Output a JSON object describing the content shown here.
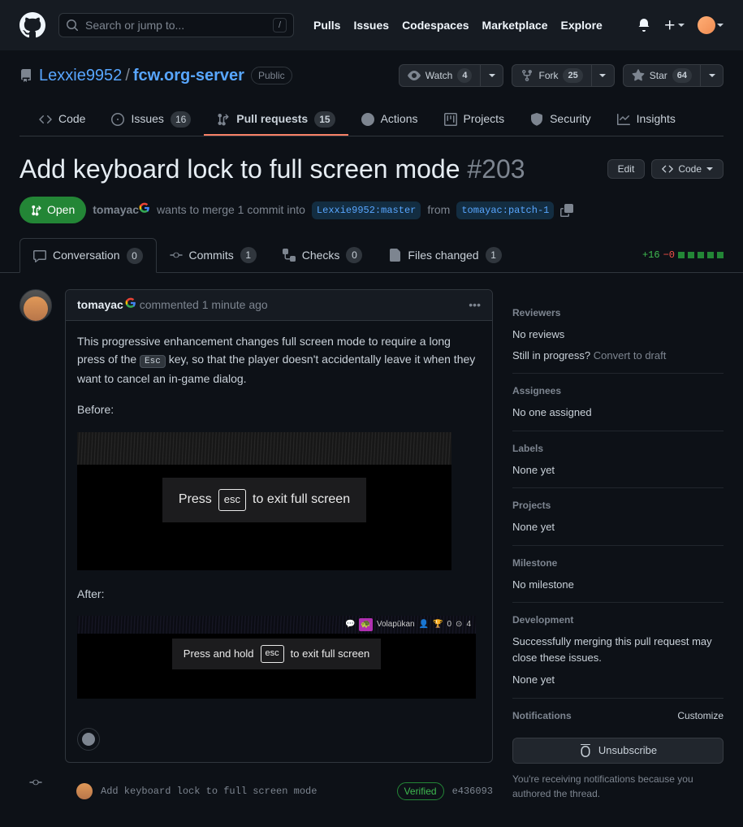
{
  "search": {
    "placeholder": "Search or jump to...",
    "slash": "/"
  },
  "topnav": {
    "pulls": "Pulls",
    "issues": "Issues",
    "codespaces": "Codespaces",
    "marketplace": "Marketplace",
    "explore": "Explore"
  },
  "repo": {
    "owner": "Lexxie9952",
    "name": "fcw.org-server",
    "visibility": "Public"
  },
  "repoActions": {
    "watch": {
      "label": "Watch",
      "count": "4"
    },
    "fork": {
      "label": "Fork",
      "count": "25"
    },
    "star": {
      "label": "Star",
      "count": "64"
    }
  },
  "repoTabs": {
    "code": "Code",
    "issues": {
      "label": "Issues",
      "count": "16"
    },
    "pulls": {
      "label": "Pull requests",
      "count": "15"
    },
    "actions": "Actions",
    "projects": "Projects",
    "security": "Security",
    "insights": "Insights"
  },
  "pr": {
    "title": "Add keyboard lock to full screen mode",
    "number": "#203",
    "state": "Open",
    "edit": "Edit",
    "code": "Code",
    "author": "tomayac",
    "meta_wants": "wants to merge 1 commit into",
    "base": "Lexxie9952:master",
    "meta_from": "from",
    "head": "tomayac:patch-1"
  },
  "prTabs": {
    "conversation": {
      "label": "Conversation",
      "count": "0"
    },
    "commits": {
      "label": "Commits",
      "count": "1"
    },
    "checks": {
      "label": "Checks",
      "count": "0"
    },
    "files": {
      "label": "Files changed",
      "count": "1"
    },
    "plus": "+16",
    "minus": "−0"
  },
  "comment": {
    "author": "tomayac",
    "time": "commented 1 minute ago",
    "p1a": "This progressive enhancement changes full screen mode to require a long press of the ",
    "p1key": "Esc",
    "p1b": " key, so that the player doesn't accidentally leave it when they want to cancel an in-game dialog.",
    "before": "Before:",
    "after": "After:",
    "fs1_a": "Press",
    "fs1_key": "esc",
    "fs1_b": "to exit full screen",
    "fs2_a": "Press and hold",
    "fs2_key": "esc",
    "fs2_b": "to exit full screen",
    "vol": "Volapūkan",
    "stats": "0",
    "o": "4"
  },
  "commit": {
    "msg": "Add keyboard lock to full screen mode",
    "verified": "Verified",
    "sha": "e436093"
  },
  "sidebar": {
    "reviewers": {
      "title": "Reviewers",
      "no": "No reviews",
      "progress": "Still in progress?",
      "convert": "Convert to draft"
    },
    "assignees": {
      "title": "Assignees",
      "val": "No one assigned"
    },
    "labels": {
      "title": "Labels",
      "val": "None yet"
    },
    "projects": {
      "title": "Projects",
      "val": "None yet"
    },
    "milestone": {
      "title": "Milestone",
      "val": "No milestone"
    },
    "development": {
      "title": "Development",
      "msg": "Successfully merging this pull request may close these issues.",
      "val": "None yet"
    },
    "notifications": {
      "title": "Notifications",
      "customize": "Customize",
      "unsubscribe": "Unsubscribe",
      "note": "You're receiving notifications because you authored the thread."
    }
  }
}
